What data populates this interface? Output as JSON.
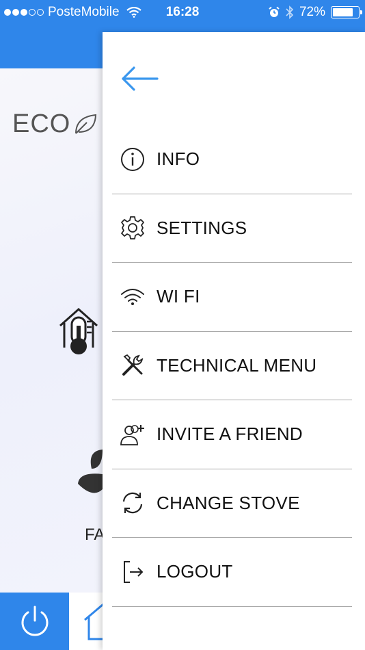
{
  "status_bar": {
    "carrier": "PosteMobile",
    "time": "16:28",
    "battery_percent": "72%"
  },
  "background": {
    "mode_label": "ECO",
    "fan_label_partial": "FA"
  },
  "drawer": {
    "items": [
      {
        "label": "INFO",
        "icon": "info-icon"
      },
      {
        "label": "SETTINGS",
        "icon": "gear-icon"
      },
      {
        "label": "WI FI",
        "icon": "wifi-icon"
      },
      {
        "label": "TECHNICAL MENU",
        "icon": "tools-icon"
      },
      {
        "label": "INVITE A FRIEND",
        "icon": "add-friend-icon"
      },
      {
        "label": "CHANGE STOVE",
        "icon": "refresh-icon"
      },
      {
        "label": "LOGOUT",
        "icon": "logout-icon"
      }
    ]
  },
  "colors": {
    "accent": "#2f86ea",
    "back_arrow": "#3a97ee",
    "divider": "#a9a9a9"
  }
}
